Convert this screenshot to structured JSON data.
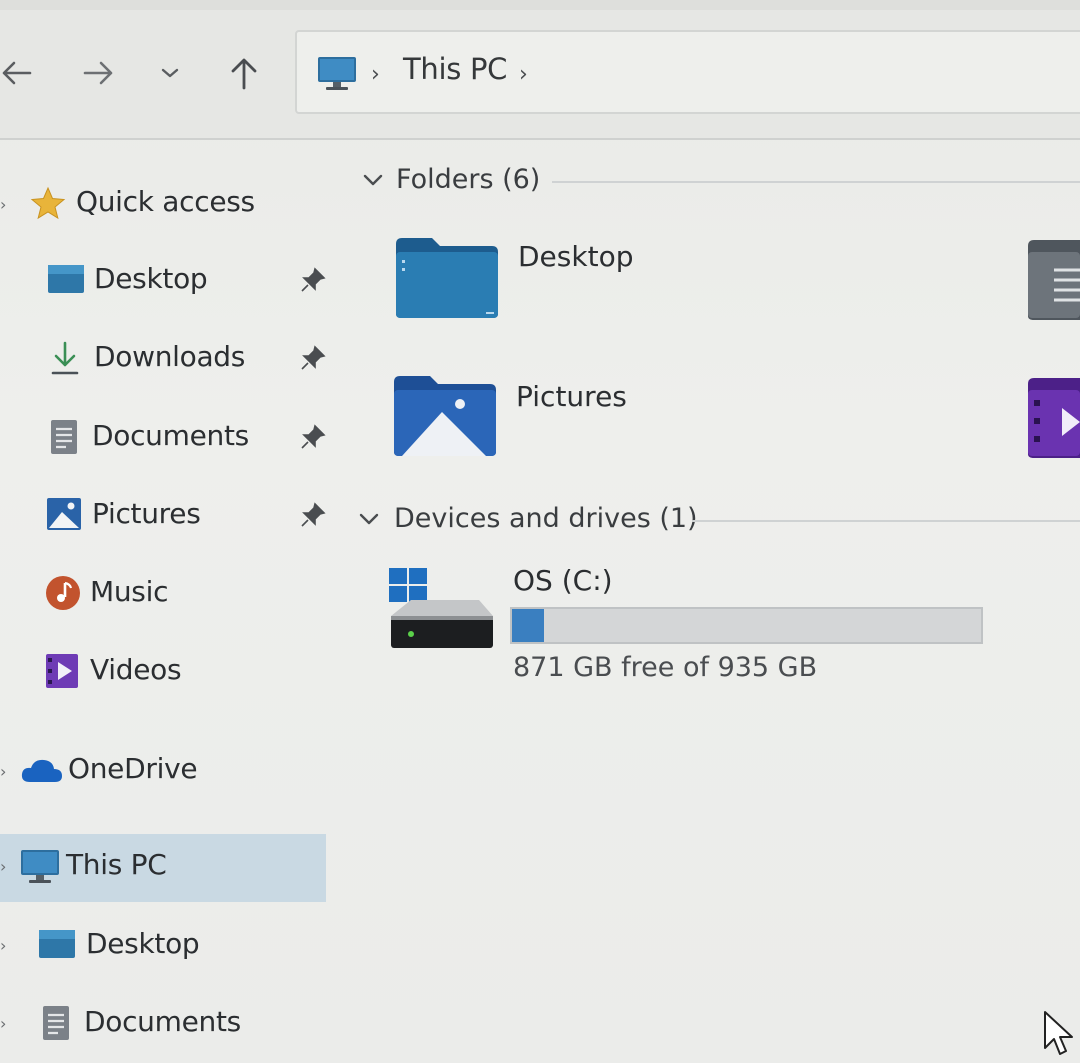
{
  "navbar": {
    "back_icon": "arrow-left-icon",
    "forward_icon": "arrow-right-icon",
    "recent_icon": "chevron-down-icon",
    "up_icon": "arrow-up-icon",
    "address": {
      "icon": "monitor-icon",
      "path_label": "This PC"
    }
  },
  "sidebar": {
    "quick_access": {
      "label": "Quick access",
      "icon": "star-icon"
    },
    "items": [
      {
        "label": "Desktop",
        "icon": "desktop-folder-icon",
        "pinned": true
      },
      {
        "label": "Downloads",
        "icon": "download-arrow-icon",
        "pinned": true
      },
      {
        "label": "Documents",
        "icon": "documents-icon",
        "pinned": true
      },
      {
        "label": "Pictures",
        "icon": "pictures-icon",
        "pinned": true
      },
      {
        "label": "Music",
        "icon": "music-icon",
        "pinned": false
      },
      {
        "label": "Videos",
        "icon": "videos-icon",
        "pinned": false
      }
    ],
    "onedrive": {
      "label": "OneDrive",
      "icon": "cloud-icon"
    },
    "this_pc": {
      "label": "This PC",
      "icon": "monitor-icon",
      "selected": true
    },
    "this_pc_children": [
      {
        "label": "Desktop",
        "icon": "desktop-folder-icon"
      },
      {
        "label": "Documents",
        "icon": "documents-icon"
      }
    ]
  },
  "main": {
    "folders_header": "Folders (6)",
    "folders": [
      {
        "label": "Desktop",
        "icon": "desktop-folder-icon"
      },
      {
        "label": "Pictures",
        "icon": "pictures-folder-icon"
      }
    ],
    "devices_header": "Devices and drives (1)",
    "drive": {
      "label": "OS (C:)",
      "icon": "windows-drive-icon",
      "used_fraction": 0.068,
      "free_text": "871 GB free of 935 GB",
      "bar_color": "#3a7fc0"
    }
  },
  "colors": {
    "accent": "#3a7fc0",
    "selection": "#c9d9e3",
    "background": "#ecedea"
  }
}
